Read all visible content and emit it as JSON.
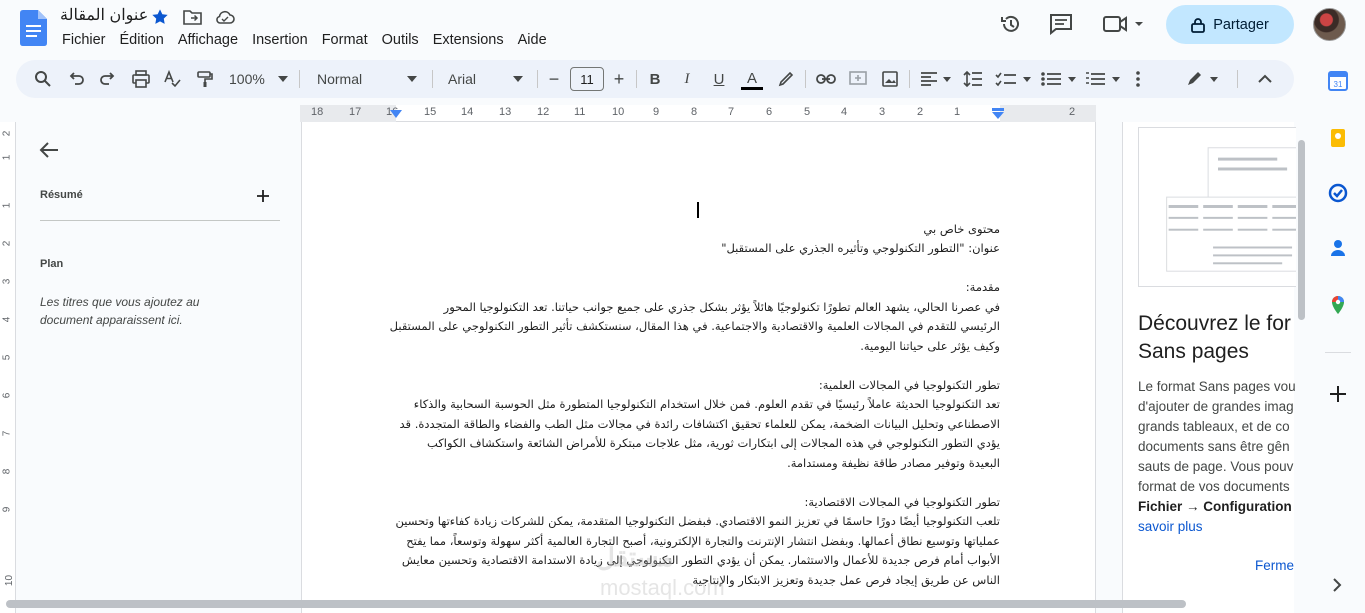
{
  "header": {
    "doc_title": "عنوان المقالة",
    "menu": [
      "Fichier",
      "Édition",
      "Affichage",
      "Insertion",
      "Format",
      "Outils",
      "Extensions",
      "Aide"
    ],
    "share_label": "Partager",
    "accent": "#0b57d0",
    "share_bg": "#c2e7ff"
  },
  "toolbar": {
    "zoom": "100%",
    "style": "Normal",
    "font": "Arial",
    "font_size": "11",
    "minus": "−",
    "plus": "+",
    "bold": "B",
    "italic": "I",
    "underline": "U",
    "text_color": "A"
  },
  "ruler": {
    "numbers": [
      "18",
      "17",
      "16",
      "15",
      "14",
      "13",
      "12",
      "11",
      "10",
      "9",
      "8",
      "7",
      "6",
      "5",
      "4",
      "3",
      "2",
      "1",
      "2"
    ]
  },
  "vruler": {
    "numbers": [
      "2",
      "1",
      "1",
      "2",
      "3",
      "4",
      "5",
      "6",
      "7",
      "8",
      "9",
      "10"
    ]
  },
  "outline": {
    "summary_label": "Résumé",
    "plan_label": "Plan",
    "hint": "Les titres que vous ajoutez au document apparaissent ici."
  },
  "document": {
    "header_line": "محتوى خاص بي",
    "lines": [
      "عنوان: \"التطور التكنولوجي وتأثيره الجذري على المستقبل\"",
      "",
      "مقدمة:",
      "في عصرنا الحالي، يشهد العالم تطورًا تكنولوجيًا هائلاً يؤثر بشكل جذري على جميع جوانب حياتنا. تعد التكنولوجيا المحور",
      "الرئيسي للتقدم في المجالات العلمية والاقتصادية والاجتماعية. في هذا المقال، سنستكشف تأثير التطور التكنولوجي على المستقبل",
      "وكيف يؤثر على حياتنا اليومية.",
      "",
      "تطور التكنولوجيا في المجالات العلمية:",
      "تعد التكنولوجيا الحديثة عاملاً رئيسيًا في تقدم العلوم. فمن خلال استخدام التكنولوجيا المتطورة مثل الحوسبة السحابية والذكاء",
      "الاصطناعي وتحليل البيانات الضخمة، يمكن للعلماء تحقيق اكتشافات رائدة في مجالات مثل الطب والفضاء والطاقة المتجددة. قد",
      "يؤدي التطور التكنولوجي في هذه المجالات إلى ابتكارات ثورية، مثل علاجات مبتكرة للأمراض الشائعة واستكشاف الكواكب",
      "البعيدة وتوفير مصادر طاقة نظيفة ومستدامة.",
      "",
      "تطور التكنولوجيا في المجالات الاقتصادية:",
      "تلعب التكنولوجيا أيضًا دورًا حاسمًا في تعزيز النمو الاقتصادي. فبفضل التكنولوجيا المتقدمة، يمكن للشركات زيادة كفاءتها وتحسين",
      "عملياتها وتوسيع نطاق أعمالها. وبفضل انتشار الإنترنت والتجارة الإلكترونية، أصبح التجارة العالمية أكثر سهولة وتوسعاً، مما يفتح",
      "الأبواب أمام فرص جديدة للأعمال والاستثمار. يمكن أن يؤدي التطور التكنولوجي إلى زيادة الاستدامة الاقتصادية وتحسين معايش",
      "الناس عن طريق إيجاد فرص عمل جديدة وتعزيز الابتكار والإنتاجية"
    ]
  },
  "side_panel": {
    "title_line1": "Découvrez le for",
    "title_line2": "Sans pages",
    "body": [
      "Le format Sans pages vou",
      "d'ajouter de grandes imag",
      "grands tableaux, et de co",
      "documents sans être gên",
      "sauts de page. Vous pouv",
      "format de vos documents"
    ],
    "path": "Fichier → Configuration d",
    "link": "savoir plus",
    "close": "Ferme"
  },
  "watermark": {
    "line1": "مستقل",
    "line2": "mostaql.com"
  }
}
